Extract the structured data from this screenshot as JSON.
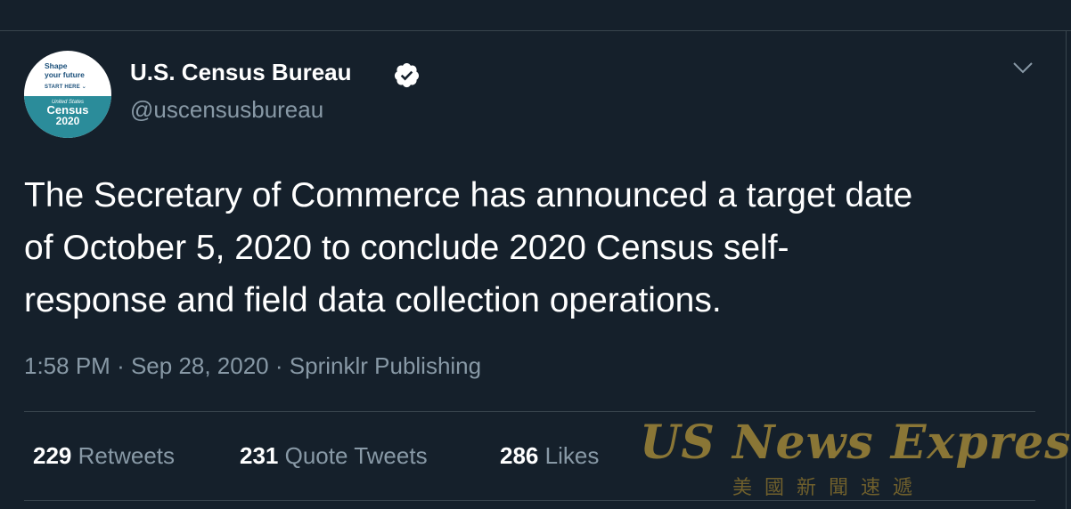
{
  "account": {
    "avatar": {
      "shape_line1": "Shape",
      "shape_line2": "your future",
      "start_here": "START HERE",
      "united_states": "United States",
      "census": "Census",
      "year": "2020"
    },
    "display_name": "U.S. Census Bureau",
    "handle": "@uscensusbureau",
    "verified": true
  },
  "tweet": {
    "text_lines": [
      "The Secretary of Commerce has announced a target date",
      "of October 5, 2020 to conclude 2020 Census self-",
      "response and field data collection operations."
    ],
    "time": "1:58 PM",
    "date": "Sep 28, 2020",
    "source": "Sprinklr Publishing"
  },
  "stats": {
    "retweets_count": "229",
    "retweets_label": "Retweets",
    "quotes_count": "231",
    "quotes_label": "Quote Tweets",
    "likes_count": "286",
    "likes_label": "Likes"
  },
  "watermark": {
    "title": "US News Express",
    "subtitle": "美國新聞速遞"
  },
  "colors": {
    "background": "#15202b",
    "secondary_text": "#8899a6",
    "border": "#38444d",
    "verified_badge": "#ffffff"
  },
  "icons": {
    "verified": "verified-badge-icon",
    "more": "chevron-down-icon"
  }
}
